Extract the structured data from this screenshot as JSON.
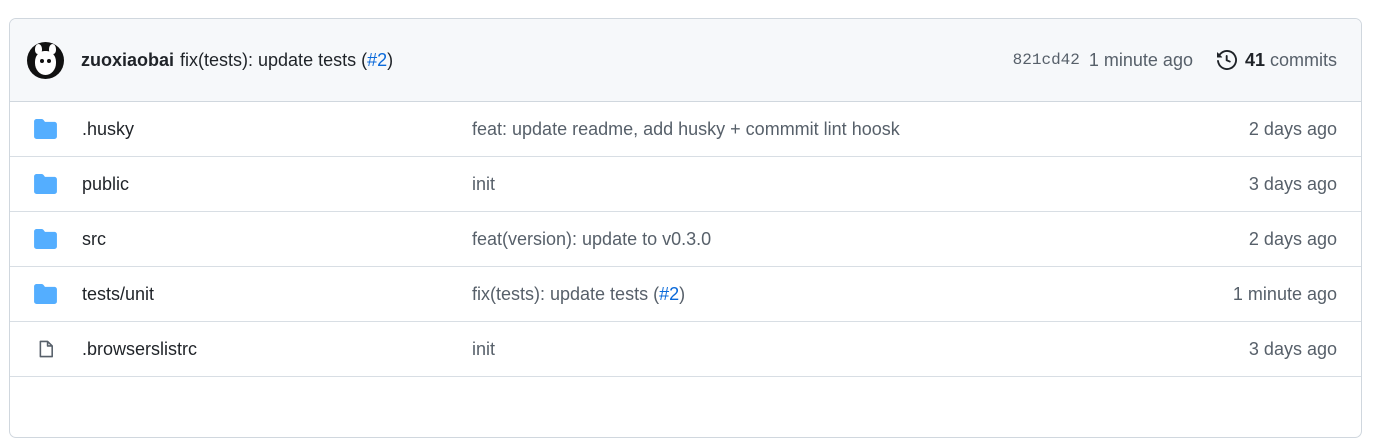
{
  "latest_commit": {
    "author": "zuoxiaobai",
    "message": "fix(tests): update tests (",
    "pr_link": "#2",
    "message_end": ")",
    "sha": "821cd42",
    "time": "1 minute ago",
    "commit_count": "41",
    "commit_label": "commits"
  },
  "files": [
    {
      "type": "folder",
      "icon": "folder-icon",
      "name": ".husky",
      "message": "feat: update readme, add husky + commmit lint hoosk",
      "date": "2 days ago"
    },
    {
      "type": "folder",
      "icon": "folder-icon",
      "name": "public",
      "message": "init",
      "date": "3 days ago"
    },
    {
      "type": "folder",
      "icon": "folder-icon",
      "name": "src",
      "message": "feat(version): update to v0.3.0",
      "date": "2 days ago"
    },
    {
      "type": "folder",
      "icon": "folder-icon",
      "name": "tests/unit",
      "message": "fix(tests): update tests (",
      "pr_link": "#2",
      "message_end": ")",
      "date": "1 minute ago"
    },
    {
      "type": "file",
      "icon": "file-icon",
      "name": ".browserslistrc",
      "message": "init",
      "date": "3 days ago"
    }
  ],
  "colors": {
    "folder": "#54aeff",
    "link": "#0969da",
    "muted": "#57606a",
    "border": "#d0d7de",
    "header_bg": "#f6f8fa"
  }
}
